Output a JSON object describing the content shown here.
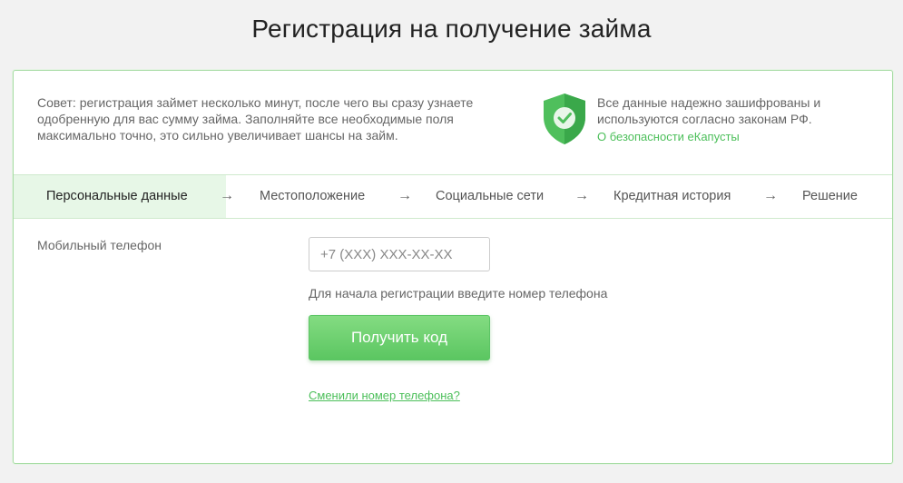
{
  "page": {
    "title": "Регистрация на получение займа"
  },
  "tip": {
    "text": "Совет: регистрация займет несколько минут, после чего вы сразу узнаете одобренную для вас сумму займа. Заполняйте все необходимые поля максимально точно, это сильно увеличивает шансы на займ."
  },
  "security": {
    "icon": "shield-check-icon",
    "text": "Все данные надежно зашифрованы и используются согласно законам РФ.",
    "link": "О безопасности еКапусты"
  },
  "steps": [
    {
      "label": "Персональные данные",
      "active": true
    },
    {
      "label": "Местоположение",
      "active": false
    },
    {
      "label": "Социальные сети",
      "active": false
    },
    {
      "label": "Кредитная история",
      "active": false
    },
    {
      "label": "Решение",
      "active": false
    }
  ],
  "step_arrow": "→",
  "form": {
    "phone_label": "Мобильный телефон",
    "phone_placeholder": "+7 (XXX) XXX-XX-XX",
    "phone_value": "",
    "hint": "Для начала регистрации введите номер телефона",
    "get_code_button": "Получить код",
    "changed_phone_link": "Сменили номер телефона?"
  },
  "colors": {
    "accent": "#5bc661",
    "link": "#4cbf5a",
    "active_step_bg": "#e7f7e7",
    "border": "#a8dca5"
  }
}
